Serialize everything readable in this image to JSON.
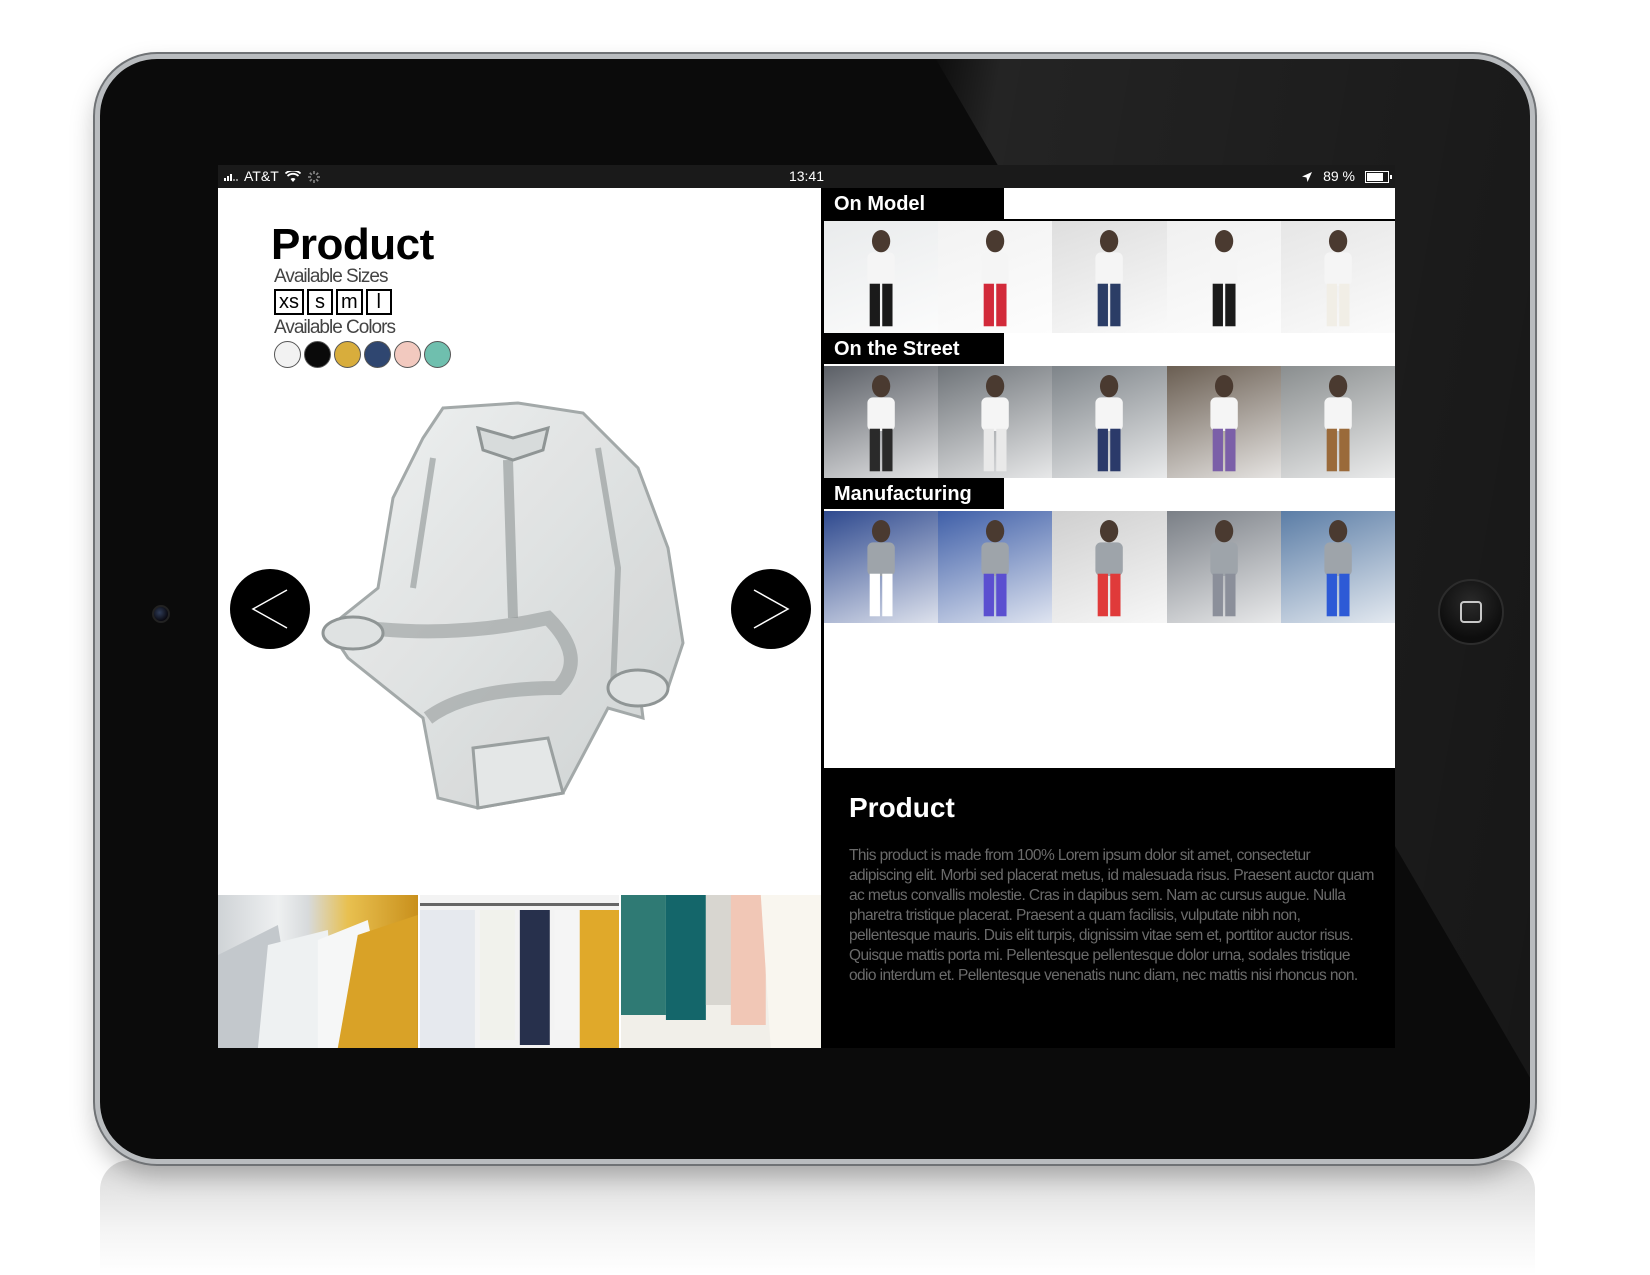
{
  "status_bar": {
    "carrier": "AT&T",
    "time": "13:41",
    "battery": "89 %",
    "battery_level": 0.89
  },
  "product": {
    "title": "Product",
    "sizes_label": "Available Sizes",
    "sizes": [
      "xs",
      "s",
      "m",
      "l"
    ],
    "colors_label": "Available Colors",
    "colors": [
      "#f2f2f2",
      "#0a0a0a",
      "#d8ad3c",
      "#2f4670",
      "#f2c9bf",
      "#6fbfae"
    ]
  },
  "sections": [
    {
      "title": "On Model",
      "thumbs": [
        "model-1",
        "model-2",
        "model-3",
        "model-4",
        "model-5"
      ]
    },
    {
      "title": "On the Street",
      "thumbs": [
        "street-1",
        "street-2",
        "street-3",
        "street-4",
        "street-5"
      ]
    },
    {
      "title": "Manufacturing",
      "thumbs": [
        "factory-1",
        "factory-2",
        "factory-3",
        "factory-4",
        "factory-5"
      ]
    }
  ],
  "description": {
    "title": "Product",
    "body": "This product is made from 100% Lorem ipsum dolor sit amet, consectetur adipiscing elit. Morbi sed placerat metus, id malesuada risus. Praesent auctor quam ac metus convallis molestie. Cras in dapibus sem. Nam ac cursus augue. Nulla pharetra tristique placerat. Praesent a quam facilisis, vulputate nibh non, pellentesque mauris. Duis elit turpis, dignissim vitae sem et, porttitor auctor risus. Quisque mattis porta mi. Pellentesque pellentesque dolor urna, sodales tristique odio interdum et. Pellentesque venenatis nunc diam, nec mattis nisi rhoncus non."
  }
}
